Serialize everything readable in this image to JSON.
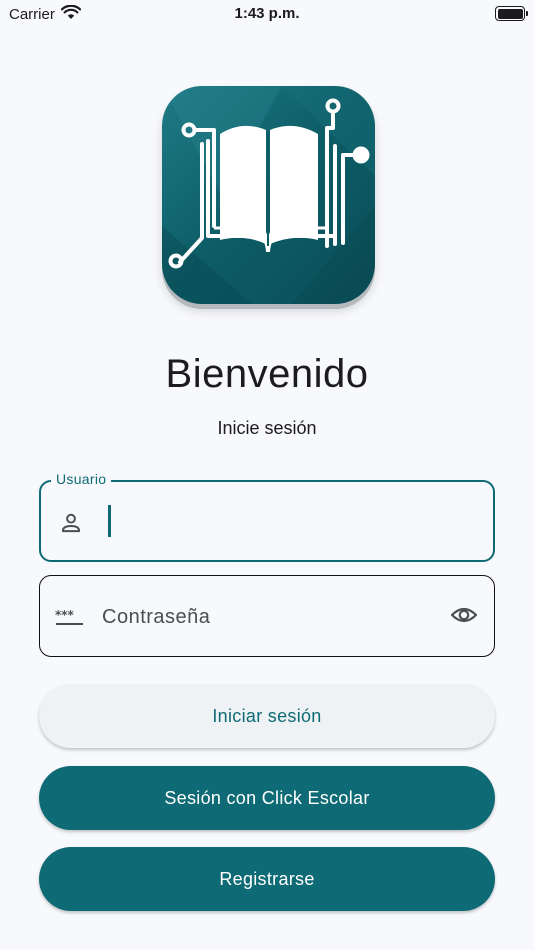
{
  "status_bar": {
    "carrier": "Carrier",
    "time": "1:43 p.m."
  },
  "header": {
    "title": "Bienvenido",
    "subtitle": "Inicie sesión"
  },
  "form": {
    "username": {
      "label": "Usuario",
      "value": ""
    },
    "password": {
      "placeholder": "Contraseña",
      "value": ""
    }
  },
  "buttons": {
    "login": "Iniciar sesión",
    "click_escolar": "Sesión con Click Escolar",
    "register": "Registrarse"
  },
  "colors": {
    "primary": "#0e6a74",
    "background": "#f8f9fc",
    "secondary_button_bg": "#eef2f4"
  },
  "icons": [
    "wifi-icon",
    "battery-icon",
    "app-logo-book-circuit",
    "person-icon",
    "password-icon",
    "eye-icon"
  ]
}
